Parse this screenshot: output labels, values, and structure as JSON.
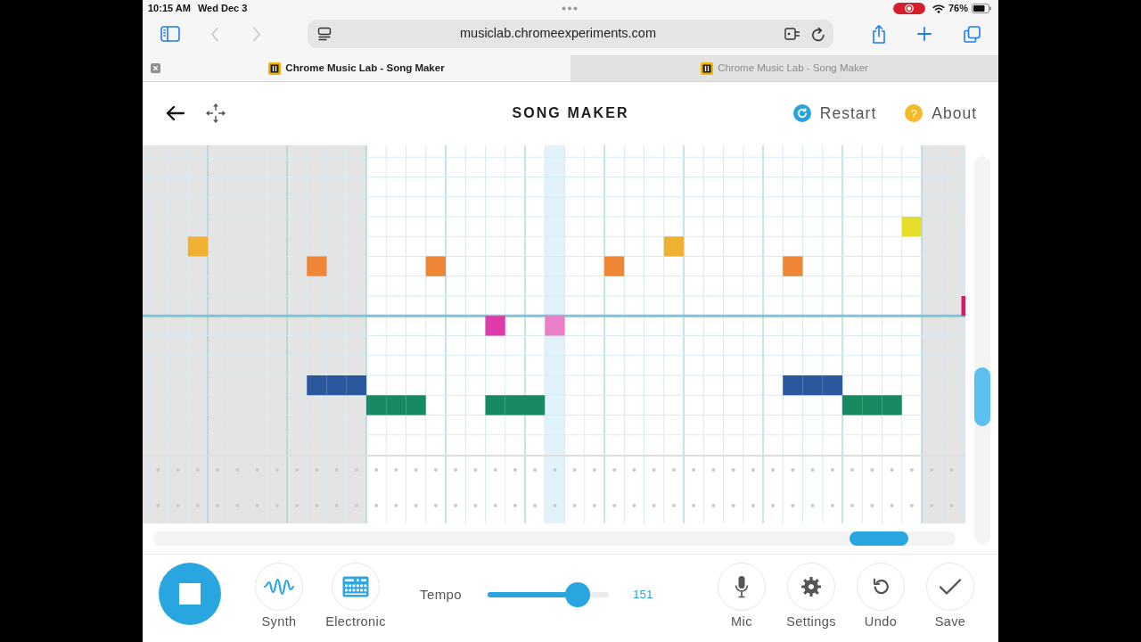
{
  "status_bar": {
    "time": "10:15 AM",
    "date": "Wed Dec 3",
    "battery": "76%"
  },
  "browser": {
    "navigation": [
      {
        "kind": "back",
        "disabled": true
      },
      {
        "kind": "forward",
        "disabled": true
      }
    ],
    "url": "musiclab.chromeexperiments.com"
  },
  "tabs": [
    {
      "title": "Chrome Music Lab - Song Maker",
      "selected": true
    },
    {
      "title": "Chrome Music Lab - Song Maker",
      "selected": false
    }
  ],
  "app_header": {
    "title": "SONG MAKER",
    "actions": [
      {
        "kind": "restart",
        "label": "Restart"
      },
      {
        "kind": "about",
        "label": "About",
        "icon_text": "?"
      }
    ]
  },
  "grid": {
    "columns": [
      {
        "shaded": true,
        "playing": false
      },
      {
        "shaded": true,
        "playing": false
      },
      {
        "shaded": true,
        "playing": false
      },
      {
        "shaded": true,
        "playing": false
      },
      {
        "shaded": true,
        "playing": false
      },
      {
        "shaded": true,
        "playing": false
      },
      {
        "shaded": true,
        "playing": false
      },
      {
        "shaded": true,
        "playing": false
      },
      {
        "shaded": true,
        "playing": false
      },
      {
        "shaded": true,
        "playing": false
      },
      {
        "shaded": true,
        "playing": false
      },
      {
        "shaded": true,
        "playing": false
      },
      {
        "shaded": false,
        "playing": false
      },
      {
        "shaded": false,
        "playing": false
      },
      {
        "shaded": false,
        "playing": false
      },
      {
        "shaded": false,
        "playing": false
      },
      {
        "shaded": false,
        "playing": false
      },
      {
        "shaded": false,
        "playing": false
      },
      {
        "shaded": false,
        "playing": false
      },
      {
        "shaded": false,
        "playing": false
      },
      {
        "shaded": false,
        "playing": false
      },
      {
        "shaded": false,
        "playing": true
      },
      {
        "shaded": false,
        "playing": false
      },
      {
        "shaded": false,
        "playing": false
      },
      {
        "shaded": false,
        "playing": false
      },
      {
        "shaded": false,
        "playing": false
      },
      {
        "shaded": false,
        "playing": false
      },
      {
        "shaded": false,
        "playing": false
      },
      {
        "shaded": false,
        "playing": false
      },
      {
        "shaded": false,
        "playing": false
      },
      {
        "shaded": false,
        "playing": false
      },
      {
        "shaded": false,
        "playing": false
      },
      {
        "shaded": false,
        "playing": false
      },
      {
        "shaded": false,
        "playing": false
      },
      {
        "shaded": false,
        "playing": false
      },
      {
        "shaded": false,
        "playing": false
      },
      {
        "shaded": false,
        "playing": false
      },
      {
        "shaded": false,
        "playing": false
      },
      {
        "shaded": false,
        "playing": false
      },
      {
        "shaded": false,
        "playing": false
      },
      {
        "shaded": true,
        "playing": false
      },
      {
        "shaded": true,
        "playing": false
      },
      {
        "shaded": true,
        "playing": false
      }
    ],
    "melody_rows": [
      {
        "octave_end": false,
        "cells": [
          null,
          null,
          null,
          null,
          null,
          null,
          null,
          null,
          null,
          null,
          null,
          null,
          null,
          null,
          null,
          null,
          null,
          null,
          null,
          null,
          null,
          null,
          null,
          null,
          null,
          null,
          null,
          null,
          null,
          null,
          null,
          null,
          null,
          null,
          null,
          null,
          null,
          null,
          null,
          null,
          null,
          null,
          null
        ]
      },
      {
        "octave_end": false,
        "cells": [
          null,
          null,
          null,
          null,
          null,
          null,
          null,
          null,
          null,
          null,
          null,
          null,
          null,
          null,
          null,
          null,
          null,
          null,
          null,
          null,
          null,
          null,
          null,
          null,
          null,
          null,
          null,
          null,
          null,
          null,
          null,
          null,
          null,
          null,
          null,
          null,
          null,
          null,
          null,
          null,
          null,
          null,
          null
        ]
      },
      {
        "octave_end": false,
        "cells": [
          null,
          null,
          null,
          null,
          null,
          null,
          null,
          null,
          null,
          null,
          null,
          null,
          null,
          null,
          null,
          null,
          null,
          null,
          null,
          null,
          null,
          null,
          null,
          null,
          null,
          null,
          null,
          null,
          null,
          null,
          null,
          null,
          null,
          null,
          null,
          null,
          null,
          null,
          null,
          null,
          null,
          null,
          null
        ]
      },
      {
        "octave_end": false,
        "cells": [
          null,
          null,
          null,
          null,
          null,
          null,
          null,
          null,
          null,
          null,
          null,
          null,
          null,
          null,
          null,
          null,
          null,
          null,
          null,
          null,
          null,
          null,
          null,
          null,
          null,
          null,
          null,
          null,
          null,
          null,
          null,
          null,
          null,
          null,
          null,
          null,
          null,
          null,
          null,
          null,
          null,
          null,
          null
        ]
      },
      {
        "octave_end": false,
        "cells": [
          null,
          null,
          null,
          null,
          null,
          null,
          null,
          null,
          null,
          null,
          null,
          null,
          null,
          null,
          null,
          null,
          null,
          null,
          null,
          null,
          null,
          null,
          null,
          null,
          null,
          null,
          null,
          null,
          null,
          null,
          null,
          null,
          null,
          null,
          null,
          null,
          null,
          null,
          null,
          {
            "color": "#e6dd2a"
          },
          null,
          null,
          null
        ]
      },
      {
        "octave_end": false,
        "cells": [
          null,
          null,
          null,
          {
            "color": "#f0b132"
          },
          null,
          null,
          null,
          null,
          null,
          null,
          null,
          null,
          null,
          null,
          null,
          null,
          null,
          null,
          null,
          null,
          null,
          null,
          null,
          null,
          null,
          null,
          null,
          {
            "color": "#f0b132"
          },
          null,
          null,
          null,
          null,
          null,
          null,
          null,
          null,
          null,
          null,
          null,
          null,
          null,
          null,
          null
        ]
      },
      {
        "octave_end": false,
        "cells": [
          null,
          null,
          null,
          null,
          null,
          null,
          null,
          null,
          null,
          {
            "color": "#ef8636"
          },
          null,
          null,
          null,
          null,
          null,
          {
            "color": "#ef8636"
          },
          null,
          null,
          null,
          null,
          null,
          null,
          null,
          null,
          {
            "color": "#ef8636"
          },
          null,
          null,
          null,
          null,
          null,
          null,
          null,
          null,
          {
            "color": "#ef8636"
          },
          null,
          null,
          null,
          null,
          null,
          null,
          null,
          null,
          null
        ]
      },
      {
        "octave_end": false,
        "cells": [
          null,
          null,
          null,
          null,
          null,
          null,
          null,
          null,
          null,
          null,
          null,
          null,
          null,
          null,
          null,
          null,
          null,
          null,
          null,
          null,
          null,
          null,
          null,
          null,
          null,
          null,
          null,
          null,
          null,
          null,
          null,
          null,
          null,
          null,
          null,
          null,
          null,
          null,
          null,
          null,
          null,
          null,
          null
        ]
      },
      {
        "octave_end": true,
        "cells": [
          null,
          null,
          null,
          null,
          null,
          null,
          null,
          null,
          null,
          null,
          null,
          null,
          null,
          null,
          null,
          null,
          null,
          null,
          null,
          null,
          null,
          null,
          null,
          null,
          null,
          null,
          null,
          null,
          null,
          null,
          null,
          null,
          null,
          null,
          null,
          null,
          null,
          null,
          null,
          null,
          null,
          null,
          {
            "color": "#d8195b"
          }
        ]
      },
      {
        "octave_end": false,
        "cells": [
          null,
          null,
          null,
          null,
          null,
          null,
          null,
          null,
          null,
          null,
          null,
          null,
          null,
          null,
          null,
          null,
          null,
          null,
          {
            "color": "#e03aaa"
          },
          null,
          null,
          {
            "color": "#eb7fc8"
          },
          null,
          null,
          null,
          null,
          null,
          null,
          null,
          null,
          null,
          null,
          null,
          null,
          null,
          null,
          null,
          null,
          null,
          null,
          null,
          null,
          null
        ]
      },
      {
        "octave_end": false,
        "cells": [
          null,
          null,
          null,
          null,
          null,
          null,
          null,
          null,
          null,
          null,
          null,
          null,
          null,
          null,
          null,
          null,
          null,
          null,
          null,
          null,
          null,
          null,
          null,
          null,
          null,
          null,
          null,
          null,
          null,
          null,
          null,
          null,
          null,
          null,
          null,
          null,
          null,
          null,
          null,
          null,
          null,
          null,
          null
        ]
      },
      {
        "octave_end": false,
        "cells": [
          null,
          null,
          null,
          null,
          null,
          null,
          null,
          null,
          null,
          null,
          null,
          null,
          null,
          null,
          null,
          null,
          null,
          null,
          null,
          null,
          null,
          null,
          null,
          null,
          null,
          null,
          null,
          null,
          null,
          null,
          null,
          null,
          null,
          null,
          null,
          null,
          null,
          null,
          null,
          null,
          null,
          null,
          null
        ]
      },
      {
        "octave_end": false,
        "cells": [
          null,
          null,
          null,
          null,
          null,
          null,
          null,
          null,
          null,
          {
            "color": "#2b579c"
          },
          {
            "color": "#2b579c"
          },
          {
            "color": "#2b579c"
          },
          null,
          null,
          null,
          null,
          null,
          null,
          null,
          null,
          null,
          null,
          null,
          null,
          null,
          null,
          null,
          null,
          null,
          null,
          null,
          null,
          null,
          {
            "color": "#2b579c"
          },
          {
            "color": "#2b579c"
          },
          {
            "color": "#2b579c"
          },
          null,
          null,
          null,
          null,
          null,
          null,
          null
        ]
      },
      {
        "octave_end": false,
        "cells": [
          null,
          null,
          null,
          null,
          null,
          null,
          null,
          null,
          null,
          null,
          null,
          null,
          {
            "color": "#178a62"
          },
          {
            "color": "#178a62"
          },
          {
            "color": "#178a62"
          },
          null,
          null,
          null,
          {
            "color": "#178a62"
          },
          {
            "color": "#178a62"
          },
          {
            "color": "#178a62"
          },
          null,
          null,
          null,
          null,
          null,
          null,
          null,
          null,
          null,
          null,
          null,
          null,
          null,
          null,
          null,
          {
            "color": "#178a62"
          },
          {
            "color": "#178a62"
          },
          {
            "color": "#178a62"
          },
          null,
          null,
          null,
          null
        ]
      },
      {
        "octave_end": false,
        "cells": [
          null,
          null,
          null,
          null,
          null,
          null,
          null,
          null,
          null,
          null,
          null,
          null,
          null,
          null,
          null,
          null,
          null,
          null,
          null,
          null,
          null,
          null,
          null,
          null,
          null,
          null,
          null,
          null,
          null,
          null,
          null,
          null,
          null,
          null,
          null,
          null,
          null,
          null,
          null,
          null,
          null,
          null,
          null
        ]
      },
      {
        "octave_end": false,
        "cells": [
          null,
          null,
          null,
          null,
          null,
          null,
          null,
          null,
          null,
          null,
          null,
          null,
          null,
          null,
          null,
          null,
          null,
          null,
          null,
          null,
          null,
          null,
          null,
          null,
          null,
          null,
          null,
          null,
          null,
          null,
          null,
          null,
          null,
          null,
          null,
          null,
          null,
          null,
          null,
          null,
          null,
          null,
          null
        ]
      }
    ],
    "percussion_rows": [
      {
        "cells": [
          false,
          false,
          false,
          false,
          false,
          false,
          false,
          false,
          false,
          false,
          false,
          false,
          false,
          false,
          false,
          false,
          false,
          false,
          false,
          false,
          false,
          false,
          false,
          false,
          false,
          false,
          false,
          false,
          false,
          false,
          false,
          false,
          false,
          false,
          false,
          false,
          false,
          false,
          false,
          false,
          false,
          false,
          false
        ]
      },
      {
        "cells": [
          false,
          false,
          false,
          false,
          false,
          false,
          false,
          false,
          false,
          false,
          false,
          false,
          false,
          false,
          false,
          false,
          false,
          false,
          false,
          false,
          false,
          false,
          false,
          false,
          false,
          false,
          false,
          false,
          false,
          false,
          false,
          false,
          false,
          false,
          false,
          false,
          false,
          false,
          false,
          false,
          false,
          false,
          false
        ]
      }
    ]
  },
  "toolbar": {
    "playing": true,
    "instruments": [
      {
        "kind": "synth",
        "label": "Synth"
      },
      {
        "kind": "electronic",
        "label": "Electronic"
      }
    ],
    "tempo": {
      "label": "Tempo",
      "level": 0.74,
      "value": "151"
    },
    "tools": [
      {
        "kind": "mic",
        "label": "Mic"
      },
      {
        "kind": "settings",
        "label": "Settings"
      },
      {
        "kind": "undo",
        "label": "Undo"
      },
      {
        "kind": "save",
        "label": "Save"
      }
    ]
  }
}
